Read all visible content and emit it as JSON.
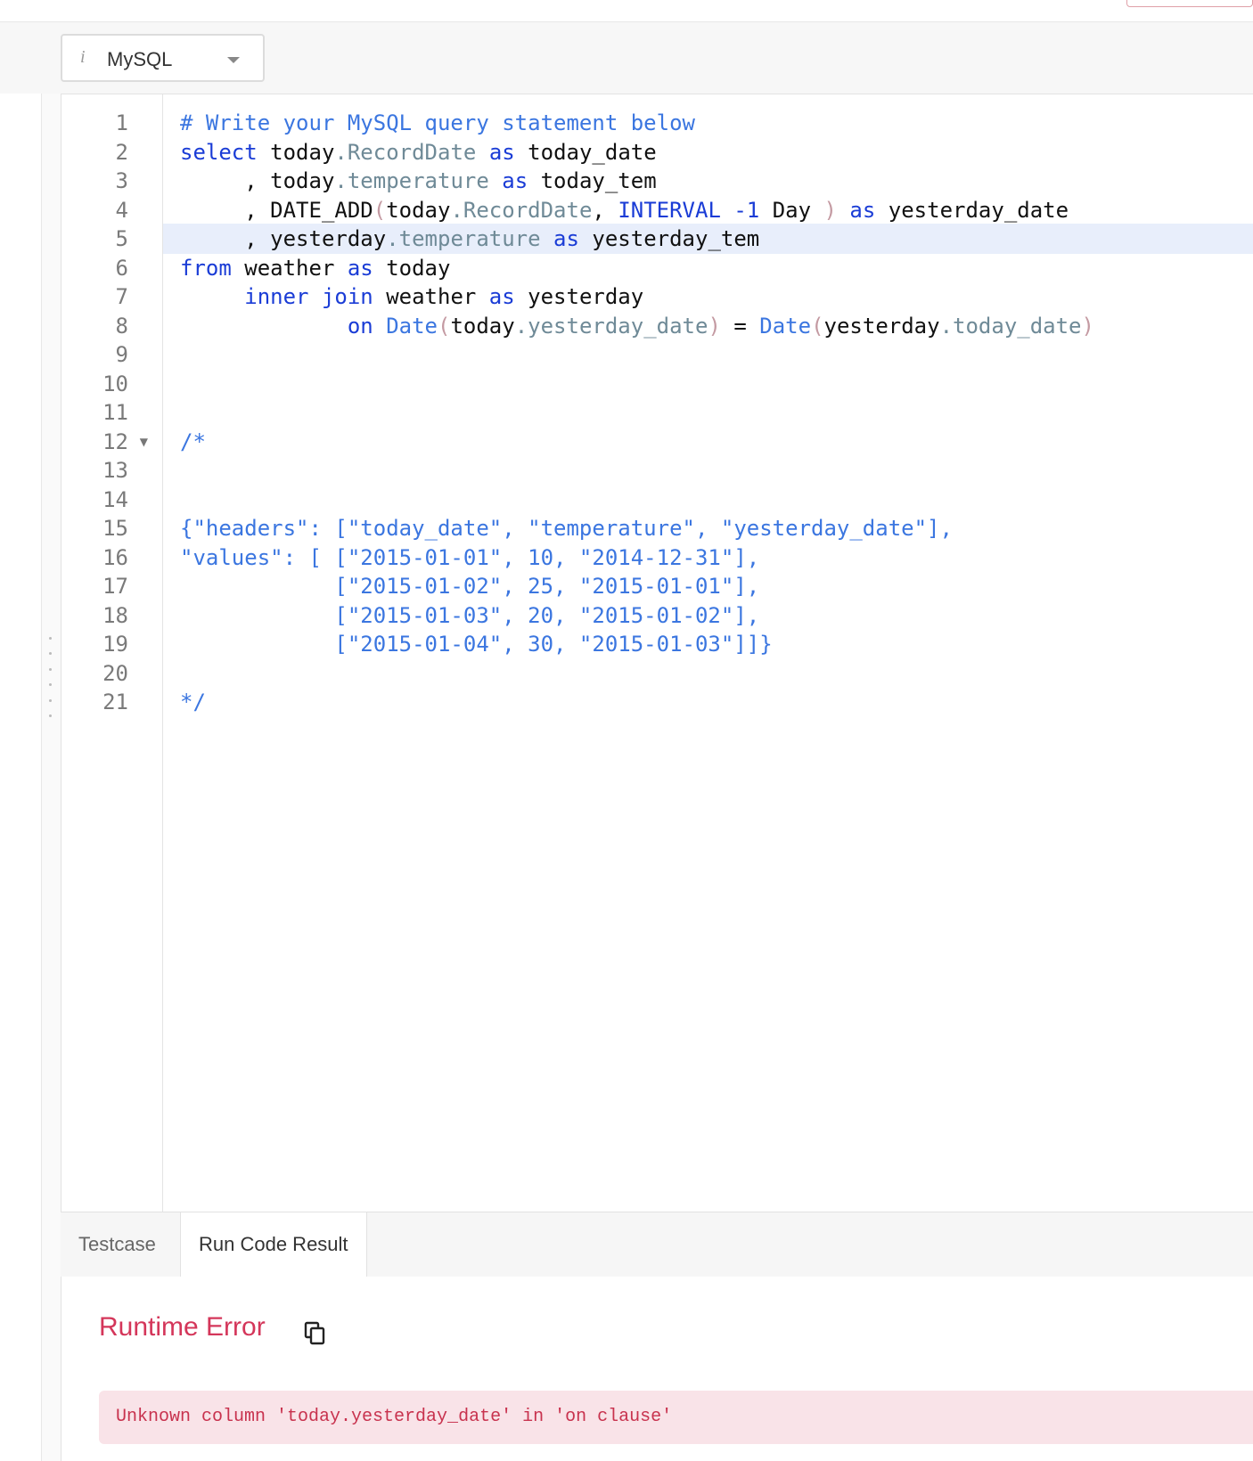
{
  "toolbar": {
    "language_icon": "info-icon",
    "language_glyph": "i",
    "language": "MySQL"
  },
  "editor": {
    "line_numbers": [
      "1",
      "2",
      "3",
      "4",
      "5",
      "6",
      "7",
      "8",
      "9",
      "10",
      "11",
      "12",
      "13",
      "14",
      "15",
      "16",
      "17",
      "18",
      "19",
      "20",
      "21"
    ],
    "active_line": 5,
    "fold_line": 12,
    "code_lines": [
      "# Write your MySQL query statement below",
      "select today.RecordDate as today_date",
      "     , today.temperature as today_tem",
      "     , DATE_ADD(today.RecordDate, INTERVAL -1 Day ) as yesterday_date",
      "     , yesterday.temperature as yesterday_tem",
      "from weather as today",
      "     inner join weather as yesterday",
      "             on Date(today.yesterday_date) = Date(yesterday.today_date)",
      "",
      "",
      "",
      "/*",
      "",
      "",
      "{\"headers\": [\"today_date\", \"temperature\", \"yesterday_date\"],",
      "\"values\": [ [\"2015-01-01\", 10, \"2014-12-31\"],",
      "            [\"2015-01-02\", 25, \"2015-01-01\"],",
      "            [\"2015-01-03\", 20, \"2015-01-02\"],",
      "            [\"2015-01-04\", 30, \"2015-01-03\"]]}",
      "",
      "*/"
    ]
  },
  "tabs": [
    {
      "label": "Testcase"
    },
    {
      "label": "Run Code Result"
    }
  ],
  "result": {
    "title": "Runtime Error",
    "copy_icon": "copy-icon",
    "message": "Unknown column 'today.yesterday_date' in 'on clause'"
  },
  "colors": {
    "keyword": "#1a3cd6",
    "comment": "#3b76e0",
    "property": "#6f8a97",
    "error": "#d4365a",
    "error_bg": "#f9e3e8",
    "active_line_bg": "#e8eefb"
  }
}
